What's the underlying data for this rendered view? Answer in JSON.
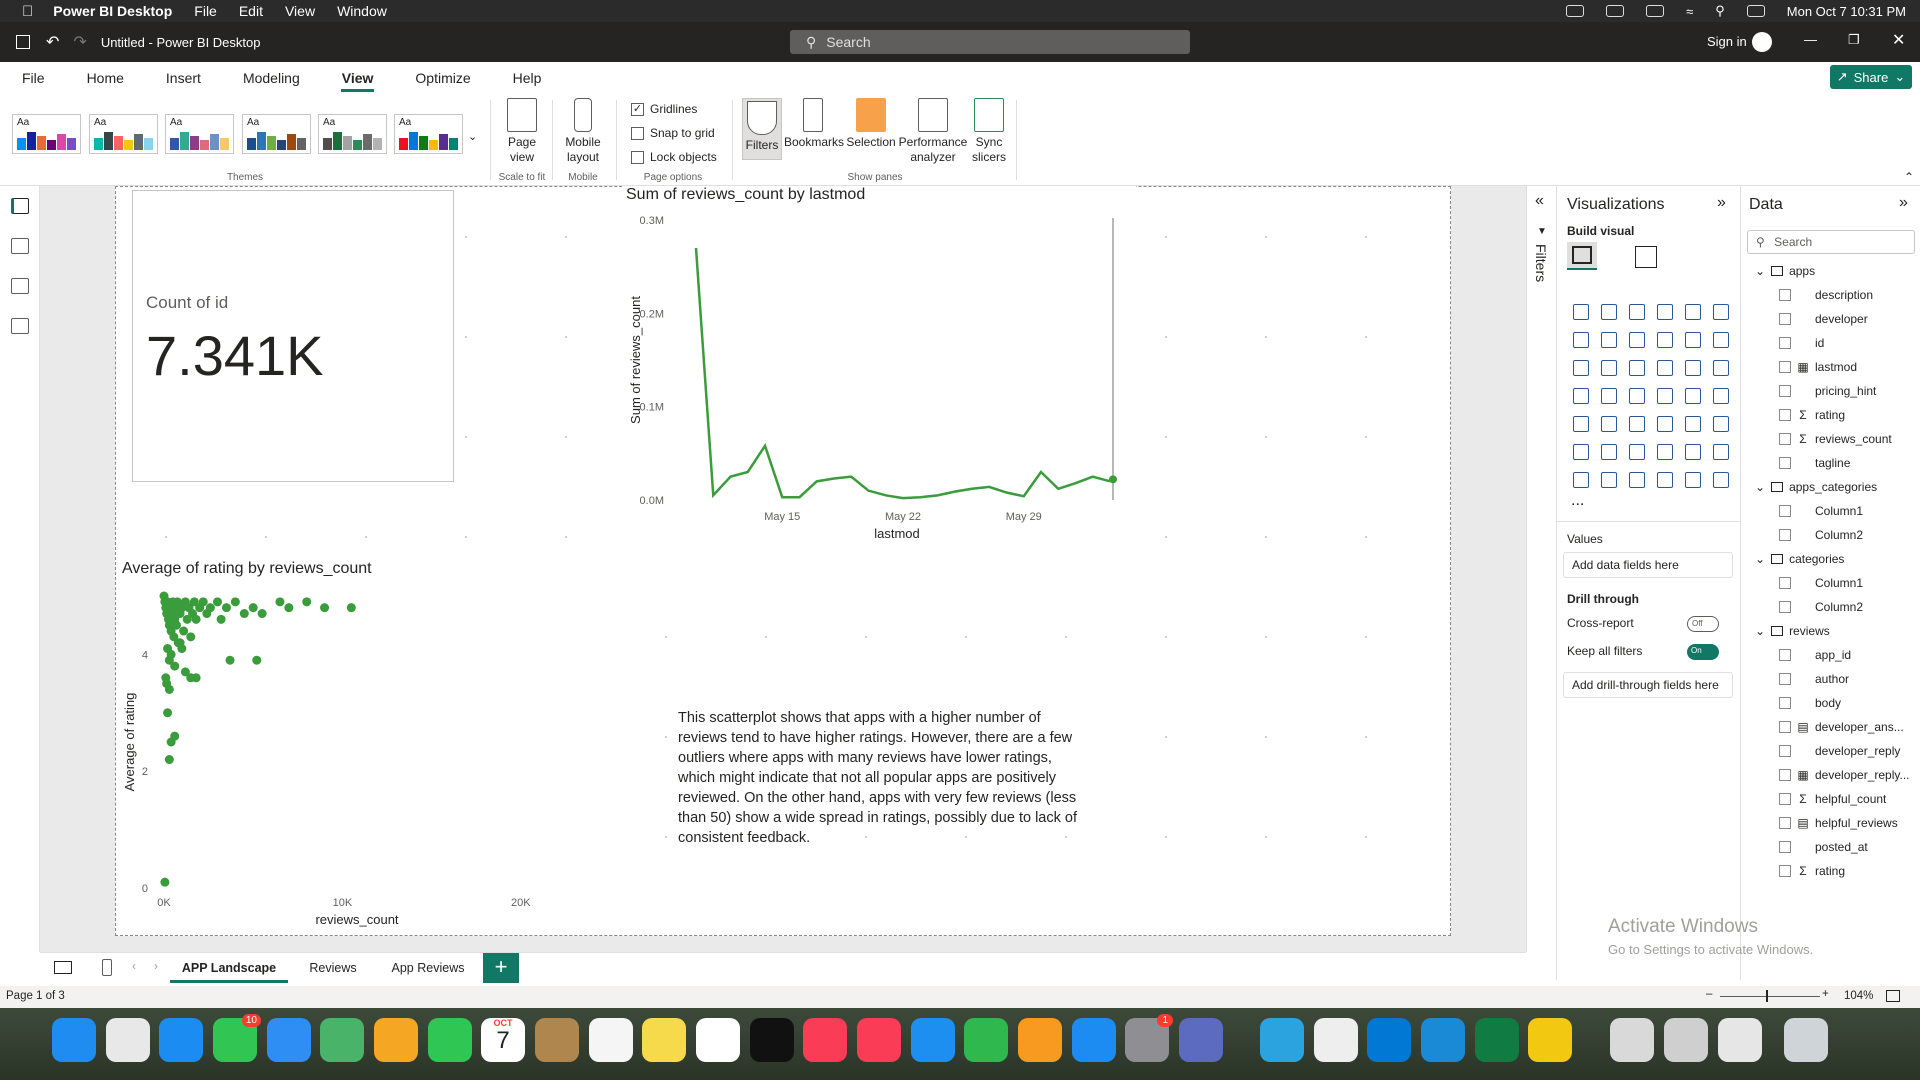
{
  "macos": {
    "app_name": "Power BI Desktop",
    "menus": [
      "File",
      "Edit",
      "View",
      "Window"
    ],
    "datetime": "Mon Oct 7  10:31 PM"
  },
  "titlebar": {
    "doc_title": "Untitled - Power BI Desktop",
    "search_placeholder": "Search",
    "signin": "Sign in"
  },
  "ribbon": {
    "tabs": [
      "File",
      "Home",
      "Insert",
      "Modeling",
      "View",
      "Optimize",
      "Help"
    ],
    "active_tab": "View",
    "share_label": "Share",
    "groups": {
      "themes": "Themes",
      "scale_to_fit": "Scale to fit",
      "mobile": "Mobile",
      "page_options": "Page options",
      "show_panes": "Show panes"
    },
    "page_view_label": "Page view",
    "mobile_layout_label": "Mobile layout",
    "page_options": [
      {
        "label": "Gridlines",
        "checked": true
      },
      {
        "label": "Snap to grid",
        "checked": false
      },
      {
        "label": "Lock objects",
        "checked": false
      }
    ],
    "show_panes": [
      "Filters",
      "Bookmarks",
      "Selection",
      "Performance analyzer",
      "Sync slicers"
    ],
    "theme_swatch_text": "Aa"
  },
  "card": {
    "label": "Count of id",
    "value": "7.341K"
  },
  "line_chart_title": "Sum of reviews_count by lastmod",
  "scatter_chart_title": "Average of rating by reviews_count",
  "chart_data": [
    {
      "type": "line",
      "title": "Sum of reviews_count by lastmod",
      "xlabel": "lastmod",
      "ylabel": "Sum of reviews_count",
      "x_ticks": [
        "May 15",
        "May 22",
        "May 29"
      ],
      "y_ticks": [
        "0.0M",
        "0.1M",
        "0.2M",
        "0.3M"
      ],
      "ylim": [
        0,
        300000
      ],
      "x": [
        "May 10",
        "May 11",
        "May 12",
        "May 13",
        "May 14",
        "May 15",
        "May 16",
        "May 17",
        "May 18",
        "May 19",
        "May 20",
        "May 21",
        "May 22",
        "May 23",
        "May 24",
        "May 25",
        "May 26",
        "May 27",
        "May 28",
        "May 29",
        "May 30",
        "May 31",
        "Jun 1",
        "Jun 2",
        "Jun 3"
      ],
      "values": [
        270000,
        5000,
        25000,
        30000,
        58000,
        3000,
        3000,
        20000,
        23000,
        25000,
        10000,
        5000,
        2000,
        3000,
        5000,
        9000,
        12000,
        14000,
        8000,
        4000,
        30000,
        12000,
        18000,
        25000,
        20000
      ],
      "series_color": "#3a9c3a",
      "grid": false
    },
    {
      "type": "scatter",
      "title": "Average of rating by reviews_count",
      "xlabel": "reviews_count",
      "ylabel": "Average of rating",
      "x_ticks": [
        "0K",
        "10K",
        "20K"
      ],
      "y_ticks": [
        "0",
        "2",
        "4"
      ],
      "xlim": [
        0,
        25000
      ],
      "ylim": [
        0,
        5
      ],
      "points": [
        [
          0,
          5
        ],
        [
          50,
          4.9
        ],
        [
          100,
          4.8
        ],
        [
          150,
          4.7
        ],
        [
          200,
          4.9
        ],
        [
          250,
          4.6
        ],
        [
          300,
          4.5
        ],
        [
          350,
          4.8
        ],
        [
          400,
          4.4
        ],
        [
          450,
          4.7
        ],
        [
          500,
          4.9
        ],
        [
          550,
          4.3
        ],
        [
          600,
          4.6
        ],
        [
          650,
          4.8
        ],
        [
          700,
          4.5
        ],
        [
          750,
          4.9
        ],
        [
          800,
          4.2
        ],
        [
          900,
          4.7
        ],
        [
          1000,
          4.8
        ],
        [
          1100,
          4.4
        ],
        [
          1200,
          4.9
        ],
        [
          1300,
          4.6
        ],
        [
          1400,
          4.8
        ],
        [
          1500,
          4.3
        ],
        [
          1600,
          4.7
        ],
        [
          1700,
          4.9
        ],
        [
          1800,
          4.6
        ],
        [
          2000,
          4.8
        ],
        [
          2200,
          4.9
        ],
        [
          2400,
          4.7
        ],
        [
          2600,
          4.8
        ],
        [
          3000,
          4.9
        ],
        [
          3200,
          4.6
        ],
        [
          3500,
          4.8
        ],
        [
          4000,
          4.9
        ],
        [
          4500,
          4.7
        ],
        [
          5000,
          4.8
        ],
        [
          5500,
          4.7
        ],
        [
          6500,
          4.9
        ],
        [
          7000,
          4.8
        ],
        [
          8000,
          4.9
        ],
        [
          9000,
          4.8
        ],
        [
          10500,
          4.8
        ],
        [
          200,
          4.1
        ],
        [
          300,
          3.9
        ],
        [
          400,
          4.0
        ],
        [
          600,
          3.8
        ],
        [
          900,
          4.2
        ],
        [
          1000,
          4.1
        ],
        [
          1200,
          3.7
        ],
        [
          1500,
          3.6
        ],
        [
          1800,
          3.6
        ],
        [
          3700,
          3.9
        ],
        [
          5200,
          3.9
        ],
        [
          100,
          3.6
        ],
        [
          150,
          3.5
        ],
        [
          300,
          3.4
        ],
        [
          200,
          3.0
        ],
        [
          400,
          2.5
        ],
        [
          600,
          2.6
        ],
        [
          300,
          2.2
        ],
        [
          50,
          0.1
        ]
      ],
      "series_color": "#3a9c3a"
    }
  ],
  "textbox": "This scatterplot shows that apps with a higher number of reviews tend to have higher ratings. However, there are a few outliers where apps with many reviews have lower ratings, which might indicate that not all popular apps are positively reviewed. On the other hand, apps with very few reviews (less than 50) show a wide spread in ratings, possibly due to lack of consistent feedback.",
  "filters_label": "Filters",
  "viz_pane": {
    "title": "Visualizations",
    "build_visual": "Build visual",
    "more": "...",
    "values_label": "Values",
    "values_placeholder": "Add data fields here",
    "drill_through": "Drill through",
    "cross_report": "Cross-report",
    "cross_report_state": "Off",
    "keep_filters": "Keep all filters",
    "keep_filters_state": "On",
    "drill_placeholder": "Add drill-through fields here"
  },
  "data_pane": {
    "title": "Data",
    "search_placeholder": "Search",
    "tables": [
      {
        "name": "apps",
        "fields": [
          {
            "name": "description"
          },
          {
            "name": "developer"
          },
          {
            "name": "id"
          },
          {
            "name": "lastmod",
            "kind": "date"
          },
          {
            "name": "pricing_hint"
          },
          {
            "name": "rating",
            "kind": "sum"
          },
          {
            "name": "reviews_count",
            "kind": "sum"
          },
          {
            "name": "tagline"
          }
        ]
      },
      {
        "name": "apps_categories",
        "fields": [
          {
            "name": "Column1"
          },
          {
            "name": "Column2"
          }
        ]
      },
      {
        "name": "categories",
        "fields": [
          {
            "name": "Column1"
          },
          {
            "name": "Column2"
          }
        ]
      },
      {
        "name": "reviews",
        "fields": [
          {
            "name": "app_id"
          },
          {
            "name": "author"
          },
          {
            "name": "body"
          },
          {
            "name": "developer_ans...",
            "kind": "calc"
          },
          {
            "name": "developer_reply"
          },
          {
            "name": "developer_reply...",
            "kind": "date"
          },
          {
            "name": "helpful_count",
            "kind": "sum"
          },
          {
            "name": "helpful_reviews",
            "kind": "calc"
          },
          {
            "name": "posted_at"
          },
          {
            "name": "rating",
            "kind": "sum"
          }
        ]
      }
    ]
  },
  "pages": {
    "tabs": [
      "APP Landscape",
      "Reviews",
      "App Reviews"
    ],
    "active": "APP Landscape",
    "add_label": "+"
  },
  "status": {
    "page_info": "Page 1 of 3",
    "zoom": "104%"
  },
  "watermark": {
    "line1": "Activate Windows",
    "line2": "Go to Settings to activate Windows."
  },
  "dock": {
    "messages_badge": "10",
    "calendar_month": "OCT",
    "calendar_day": "7",
    "settings_badge": "1"
  },
  "colors": {
    "accent": "#117865",
    "chart_green": "#3a9c3a"
  }
}
